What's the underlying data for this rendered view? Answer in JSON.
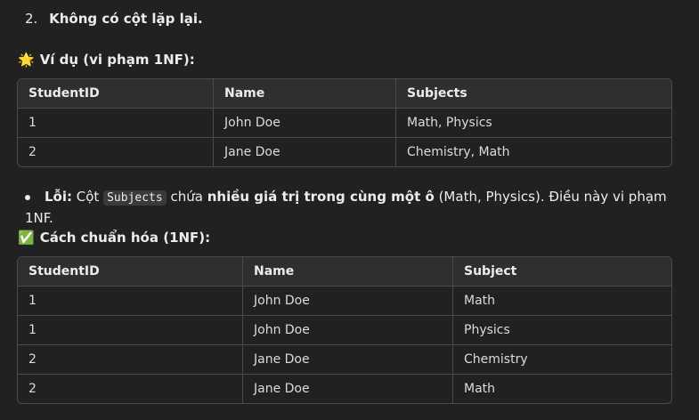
{
  "list": {
    "number": "2.",
    "text": "Không có cột lặp lại."
  },
  "example": {
    "emoji": "🌟",
    "title": "Ví dụ (vi phạm 1NF):",
    "headers": [
      "StudentID",
      "Name",
      "Subjects"
    ],
    "rows": [
      [
        "1",
        "John Doe",
        "Math, Physics"
      ],
      [
        "2",
        "Jane Doe",
        "Chemistry, Math"
      ]
    ]
  },
  "error": {
    "label": "Lỗi:",
    "t1": " Cột ",
    "code": "Subjects",
    "t2": " chứa ",
    "bold": "nhiều giá trị trong cùng một ô",
    "t3": " (Math, Physics). Điều này vi phạm 1NF."
  },
  "fix": {
    "emoji": "✅",
    "title": "Cách chuẩn hóa (1NF):",
    "headers": [
      "StudentID",
      "Name",
      "Subject"
    ],
    "rows": [
      [
        "1",
        "John Doe",
        "Math"
      ],
      [
        "1",
        "John Doe",
        "Physics"
      ],
      [
        "2",
        "Jane Doe",
        "Chemistry"
      ],
      [
        "2",
        "Jane Doe",
        "Math"
      ]
    ]
  }
}
